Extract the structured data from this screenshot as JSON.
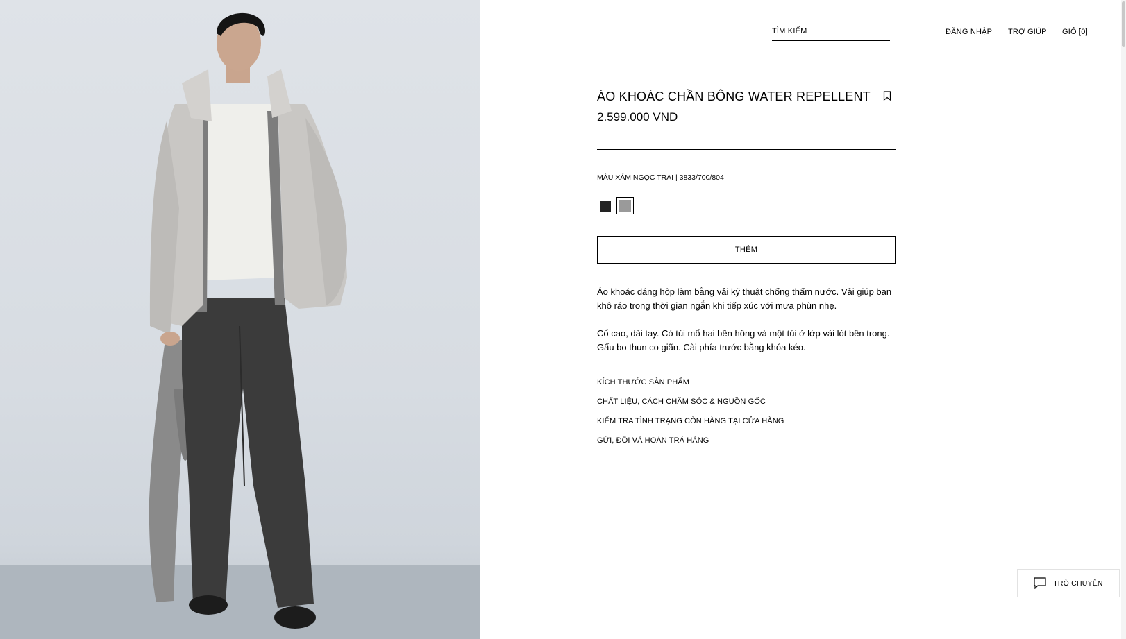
{
  "header": {
    "search_label": "TÌM KIẾM",
    "login_label": "ĐĂNG NHẬP",
    "help_label": "TRỢ GIÚP",
    "cart_label": "GIỎ [0]"
  },
  "product": {
    "title": "ÁO KHOÁC CHẦN BÔNG WATER REPELLENT",
    "price": "2.599.000 VND",
    "color_label": "MÀU XÁM NGỌC TRAI | 3833/700/804",
    "swatches": [
      {
        "name": "black",
        "color": "#222222",
        "selected": false
      },
      {
        "name": "pearl-grey",
        "color": "#9a9a9a",
        "selected": true
      }
    ],
    "add_button_label": "THÊM",
    "description": [
      "Áo khoác dáng hộp làm bằng vải kỹ thuật chống thấm nước. Vải giúp bạn khô ráo trong thời gian ngắn khi tiếp xúc với mưa phùn nhẹ.",
      "Cổ cao, dài tay. Có túi mổ hai bên hông và một túi ở lớp vải lót bên trong. Gấu bo thun co giãn. Cài phía trước bằng khóa kéo."
    ],
    "info_links": [
      "KÍCH THƯỚC SẢN PHẨM",
      "CHẤT LIỆU, CÁCH CHĂM SÓC & NGUỒN GỐC",
      "KIỂM TRA TÌNH TRẠNG CÒN HÀNG TẠI CỬA HÀNG",
      "GỬI, ĐỔI VÀ HOÀN TRẢ HÀNG"
    ]
  },
  "chat": {
    "label": "TRÒ CHUYỆN",
    "icon": "chat-icon"
  },
  "colors": {
    "text": "#000000",
    "background": "#ffffff",
    "photo_background": "#dde2e7"
  }
}
